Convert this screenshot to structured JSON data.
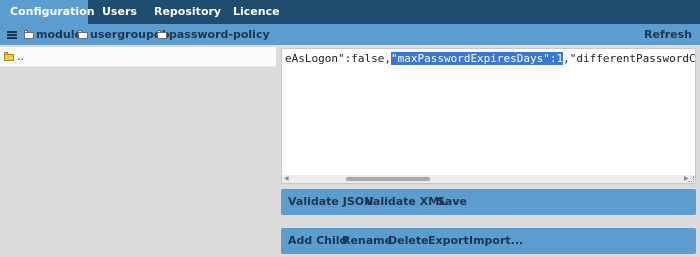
{
  "tabs": [
    {
      "label": "Configuration",
      "active": true
    },
    {
      "label": "Users",
      "active": false
    },
    {
      "label": "Repository",
      "active": false
    },
    {
      "label": "Licence",
      "active": false
    }
  ],
  "breadcrumb": [
    "module",
    "usergroupdb",
    "password-policy"
  ],
  "refresh_label": "Refresh",
  "tree": {
    "items": [
      {
        "label": ".."
      }
    ]
  },
  "editor": {
    "before": "eAsLogon\":false,",
    "selected": "\"maxPasswordExpiresDays\":1",
    "after": ",\"differentPasswordCoun"
  },
  "actions_primary": [
    "Validate JSON",
    "Validate XML",
    "Save"
  ],
  "actions_secondary": [
    "Add Child",
    "Rename",
    "Delete",
    "Export",
    "Import..."
  ],
  "colors": {
    "topbar": "#1e4d70",
    "accent": "#5b9dcf",
    "selection": "#3a78d6",
    "panel_bg": "#dcdcdc"
  }
}
